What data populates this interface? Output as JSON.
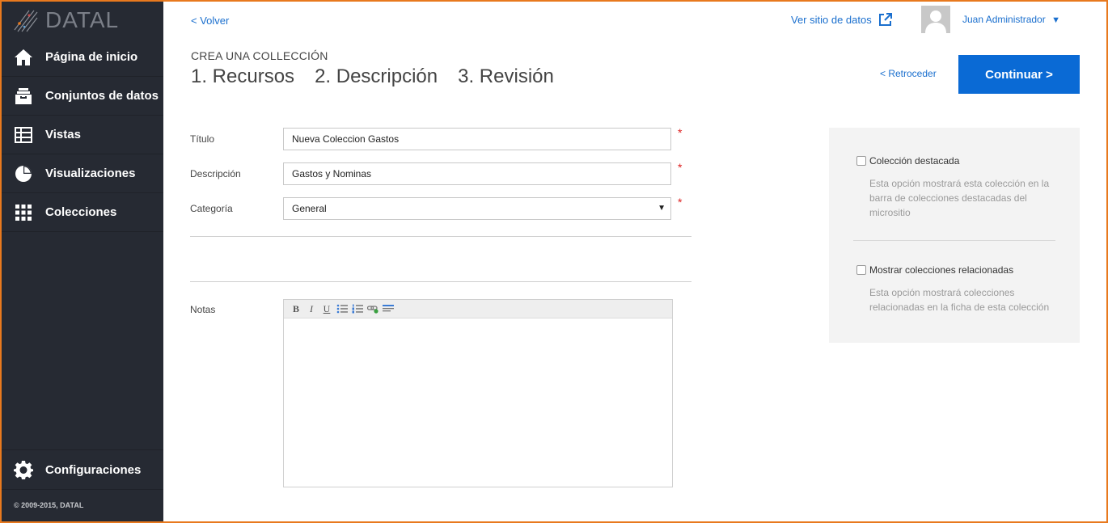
{
  "app": {
    "brand": "DATAL",
    "copyright": "© 2009-2015, DATAL"
  },
  "sidebar": {
    "items": [
      {
        "label": "Página de inicio",
        "icon": "home-icon"
      },
      {
        "label": "Conjuntos de datos",
        "icon": "inbox-icon"
      },
      {
        "label": "Vistas",
        "icon": "table-icon"
      },
      {
        "label": "Visualizaciones",
        "icon": "pie-chart-icon"
      },
      {
        "label": "Colecciones",
        "icon": "grid-icon"
      }
    ],
    "config": {
      "label": "Configuraciones",
      "icon": "gear-icon"
    }
  },
  "topbar": {
    "back": "< Volver",
    "site_link": "Ver sitio de datos",
    "user": "Juan Administrador",
    "user_caret": "▼"
  },
  "wizard": {
    "kicker": "CREA UNA COLLECCIÓN",
    "steps": [
      "1. Recursos",
      "2. Descripción",
      "3. Revisión"
    ],
    "prev": "< Retroceder",
    "continue": "Continuar >"
  },
  "form": {
    "title": {
      "label": "Título",
      "value": "Nueva Coleccion Gastos",
      "required": "*"
    },
    "description": {
      "label": "Descripción",
      "value": "Gastos y Nominas",
      "required": "*"
    },
    "category": {
      "label": "Categoría",
      "value": "General",
      "required": "*",
      "arrow": "▼"
    },
    "notes": {
      "label": "Notas"
    }
  },
  "options": {
    "featured": {
      "label": "Colección destacada",
      "help": "Esta opción mostrará esta colección en la barra de colecciones destacadas del micrositio"
    },
    "related": {
      "label": "Mostrar colecciones relacionadas",
      "help": "Esta opción mostrará colecciones relacionadas en la ficha de esta colección"
    }
  },
  "colors": {
    "accent": "#0a6ad5",
    "link": "#1a6fce",
    "sidebar": "#262a33",
    "frame": "#e8791e"
  }
}
